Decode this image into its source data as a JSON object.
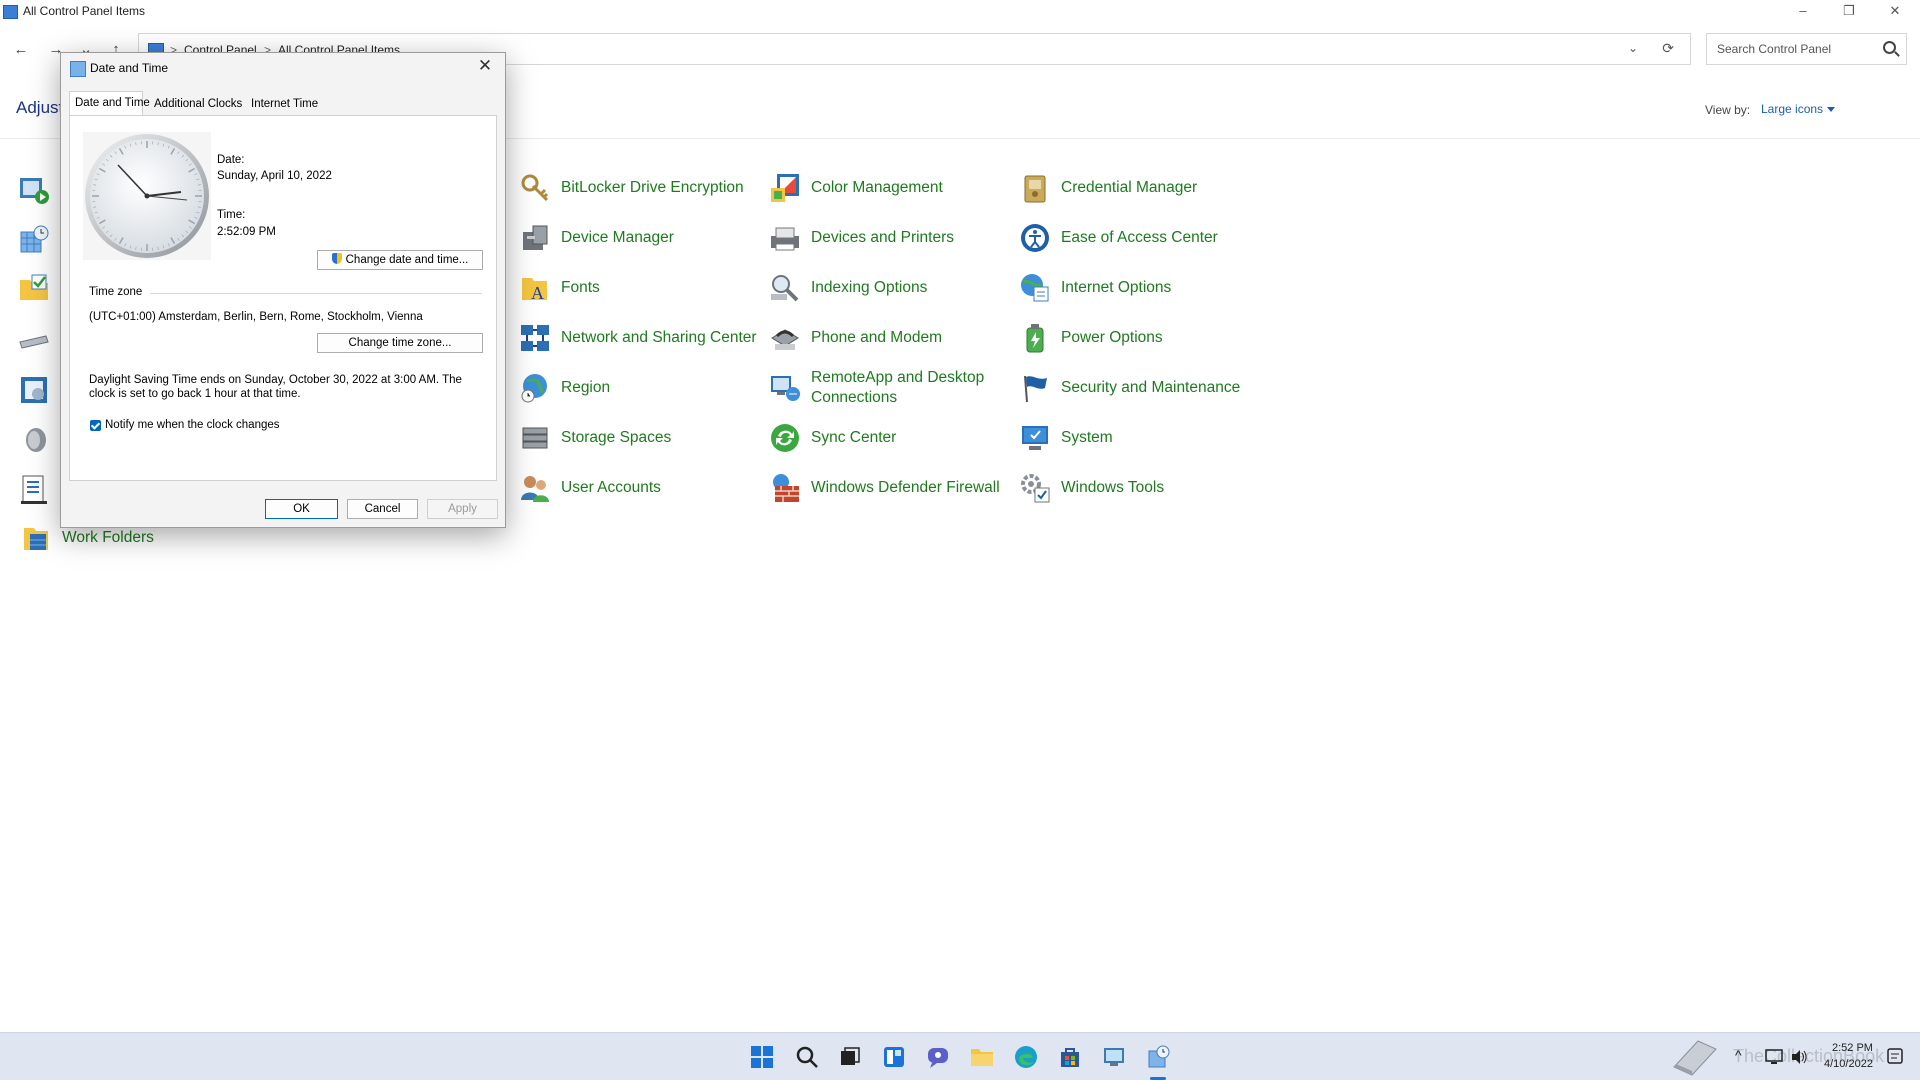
{
  "window": {
    "title": "All Control Panel Items",
    "minimize": "–",
    "restore": "❐",
    "close": "✕"
  },
  "nav": {
    "back": "←",
    "forward": "→",
    "recent": "⌄",
    "up": "↑",
    "breadcrumb": [
      "Control Panel",
      "All Control Panel Items"
    ],
    "separator": ">",
    "dropdown": "⌄",
    "refresh": "⟳",
    "search_placeholder": "Search Control Panel"
  },
  "header": {
    "heading": "Adjust",
    "view_by_label": "View by:",
    "view_by_value": "Large icons"
  },
  "items": [
    {
      "label": "BitLocker Drive Encryption",
      "icon": "bitlocker-icon"
    },
    {
      "label": "Color Management",
      "icon": "color-management-icon"
    },
    {
      "label": "Credential Manager",
      "icon": "credential-manager-icon"
    },
    {
      "label": "Device Manager",
      "icon": "device-manager-icon"
    },
    {
      "label": "Devices and Printers",
      "icon": "devices-printers-icon"
    },
    {
      "label": "Ease of Access Center",
      "icon": "ease-of-access-icon"
    },
    {
      "label": "Fonts",
      "icon": "fonts-icon"
    },
    {
      "label": "Indexing Options",
      "icon": "indexing-icon"
    },
    {
      "label": "Internet Options",
      "icon": "internet-options-icon"
    },
    {
      "label": "Network and Sharing Center",
      "icon": "network-icon"
    },
    {
      "label": "Phone and Modem",
      "icon": "phone-modem-icon"
    },
    {
      "label": "Power Options",
      "icon": "power-options-icon"
    },
    {
      "label": "Region",
      "icon": "region-icon"
    },
    {
      "label": "RemoteApp and Desktop Connections",
      "icon": "remoteapp-icon"
    },
    {
      "label": "Security and Maintenance",
      "icon": "security-flag-icon"
    },
    {
      "label": "Storage Spaces",
      "icon": "storage-spaces-icon"
    },
    {
      "label": "Sync Center",
      "icon": "sync-center-icon"
    },
    {
      "label": "System",
      "icon": "system-icon"
    },
    {
      "label": "User Accounts",
      "icon": "user-accounts-icon"
    },
    {
      "label": "Windows Defender Firewall",
      "icon": "firewall-icon"
    },
    {
      "label": "Windows Tools",
      "icon": "windows-tools-icon"
    },
    {
      "label": "Work Folders",
      "icon": "work-folders-icon"
    }
  ],
  "dialog": {
    "title": "Date and Time",
    "close": "✕",
    "tabs": [
      "Date and Time",
      "Additional Clocks",
      "Internet Time"
    ],
    "date_label": "Date:",
    "date_value": "Sunday, April 10, 2022",
    "time_label": "Time:",
    "time_value": "2:52:09 PM",
    "change_datetime_button": "Change date and time...",
    "timezone_label": "Time zone",
    "timezone_value": "(UTC+01:00) Amsterdam, Berlin, Bern, Rome, Stockholm, Vienna",
    "change_timezone_button": "Change time zone...",
    "dst_line1": "Daylight Saving Time ends on Sunday, October 30, 2022 at 3:00 AM. The",
    "dst_line2": "clock is set to go back 1 hour at that time.",
    "notify_label": "Notify me when the clock changes",
    "notify_checked": true,
    "ok": "OK",
    "cancel": "Cancel",
    "apply": "Apply"
  },
  "taskbar": {
    "apps": [
      "start-icon",
      "search-icon",
      "task-view-icon",
      "widgets-icon",
      "chat-icon",
      "file-explorer-icon",
      "edge-icon",
      "store-icon",
      "control-panel-icon",
      "date-time-icon"
    ],
    "tray_caret": "^",
    "clock_time": "2:52 PM",
    "clock_date": "4/10/2022",
    "watermark": "TheCollectionBook"
  },
  "colors": {
    "link_green": "#1f7a1f",
    "accent_blue": "#0067c0",
    "heading_blue": "#1e3287",
    "taskbar": "#dfe6f1"
  }
}
